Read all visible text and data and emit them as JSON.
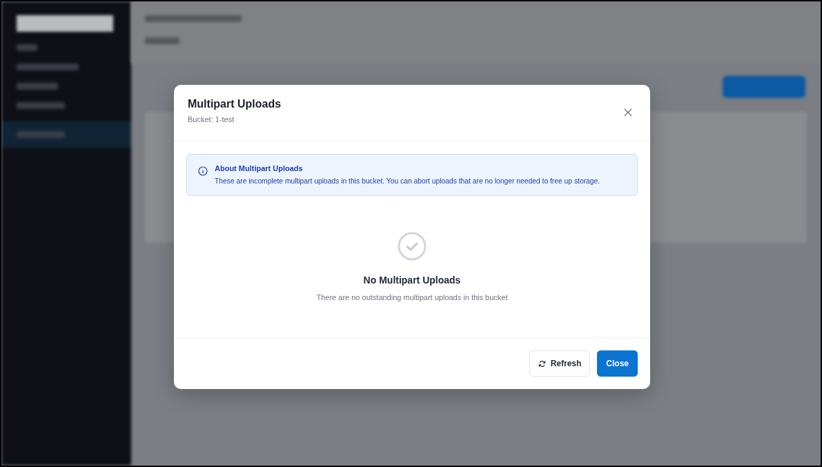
{
  "modal": {
    "title": "Multipart Uploads",
    "subtitle": "Bucket: 1-test",
    "info": {
      "title": "About Multipart Uploads",
      "text": "These are incomplete multipart uploads in this bucket. You can abort uploads that are no longer needed to free up storage."
    },
    "empty_state": {
      "title": "No Multipart Uploads",
      "text": "There are no outstanding multipart uploads in this bucket"
    },
    "buttons": [
      {
        "label": "Refresh",
        "kind": "secondary"
      },
      {
        "label": "Close",
        "kind": "primary"
      }
    ]
  }
}
